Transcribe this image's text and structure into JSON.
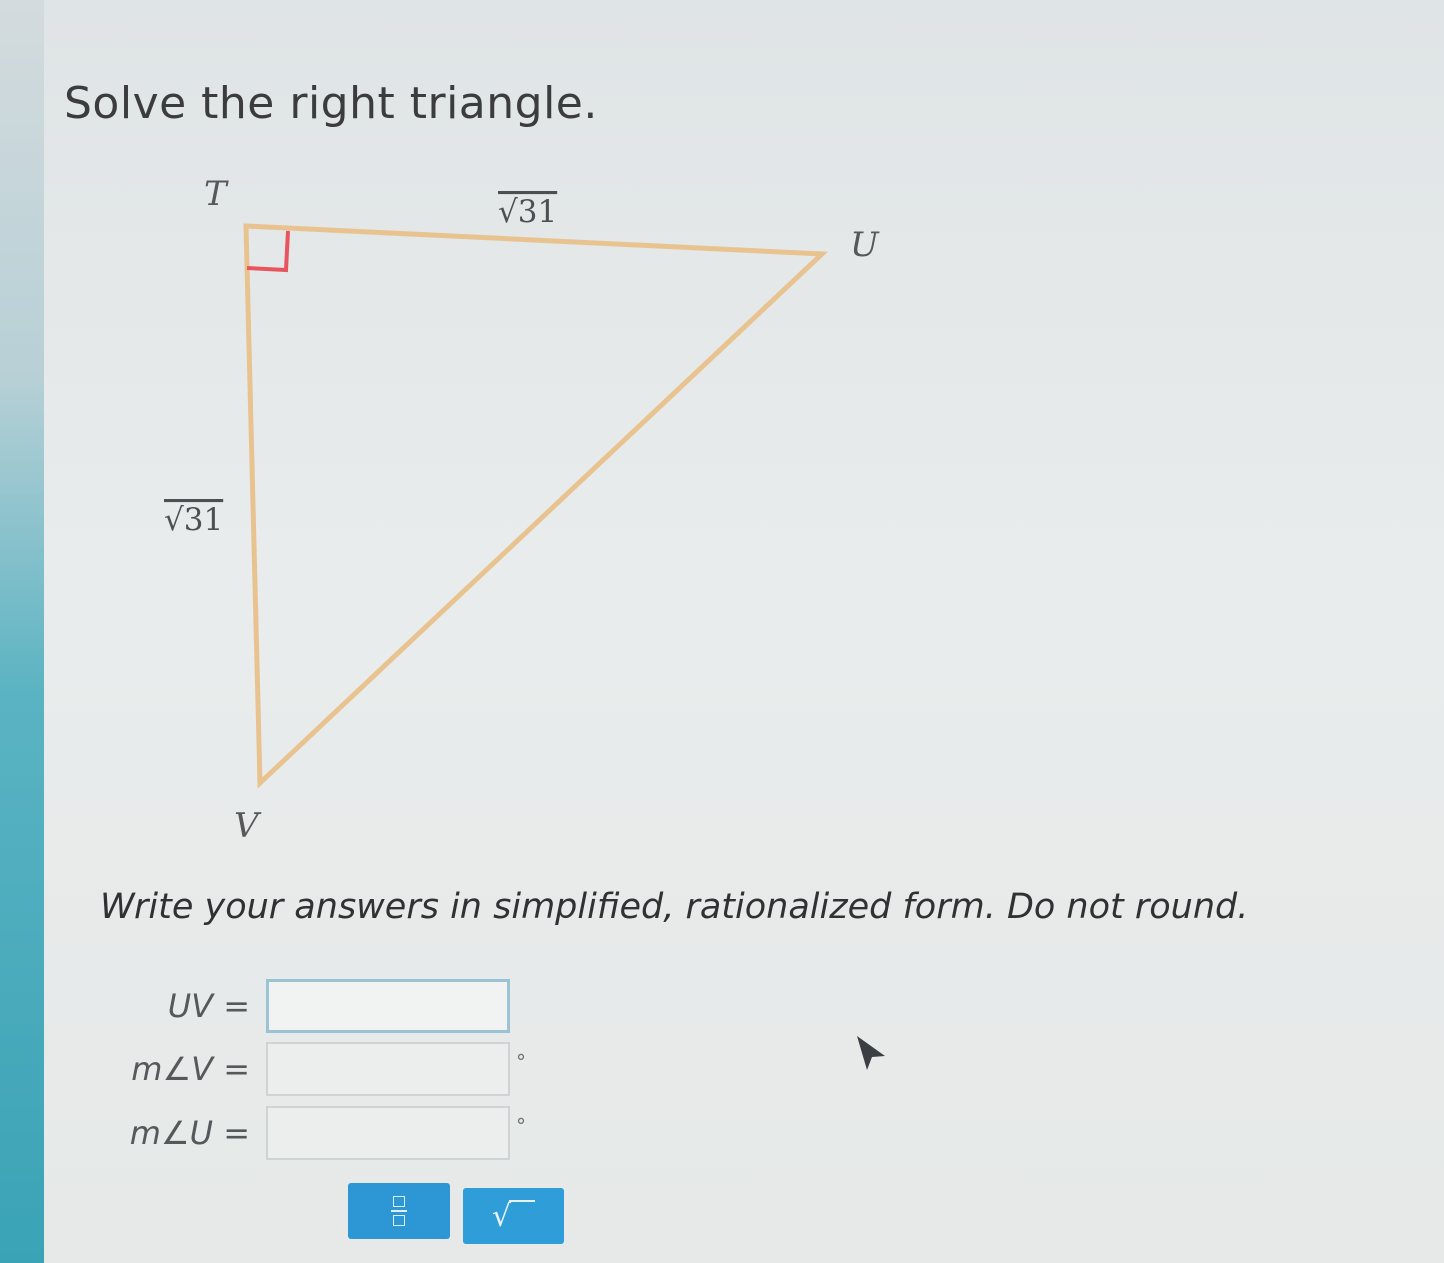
{
  "problem": {
    "prompt": "Solve the right triangle."
  },
  "figure": {
    "vertices": {
      "T": "T",
      "U": "U",
      "V": "V"
    },
    "side_TU_label": "√31",
    "side_TV_label": "√31",
    "right_angle_at": "T",
    "colors": {
      "triangle_stroke": "#e9c38f",
      "right_angle_marker": "#e8555f"
    }
  },
  "instructions": "Write your answers in simplified, rationalized form. Do not round.",
  "answers": [
    {
      "label": "UV =",
      "value": "",
      "unit": ""
    },
    {
      "label": "m∠V =",
      "value": "",
      "unit": "°"
    },
    {
      "label": "m∠U =",
      "value": "",
      "unit": "°"
    }
  ],
  "toolbar": {
    "fraction_icon": "fraction-icon",
    "sqrt_icon": "square-root-icon",
    "button_color": "#2d97d6"
  }
}
